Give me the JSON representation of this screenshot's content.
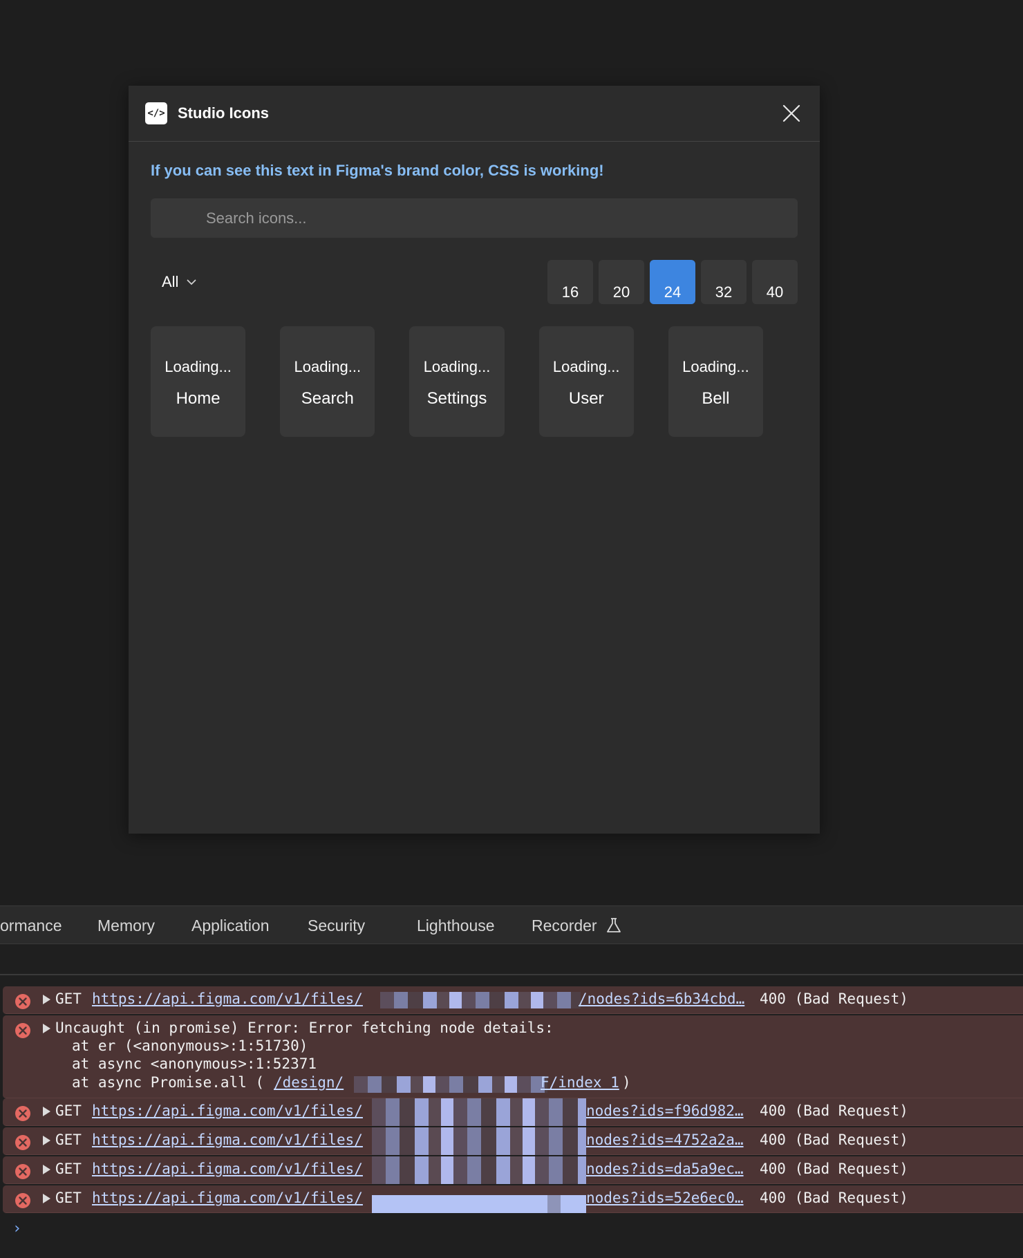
{
  "plugin": {
    "icon_glyph": "</>",
    "title": "Studio Icons",
    "css_message": "If you can see this text in Figma's brand color, CSS is working!",
    "search_placeholder": "Search icons...",
    "filter_value": "All",
    "sizes": [
      "16",
      "20",
      "24",
      "32",
      "40"
    ],
    "selected_size": "24",
    "icons": [
      {
        "status": "Loading...",
        "name": "Home"
      },
      {
        "status": "Loading...",
        "name": "Search"
      },
      {
        "status": "Loading...",
        "name": "Settings"
      },
      {
        "status": "Loading...",
        "name": "User"
      },
      {
        "status": "Loading...",
        "name": "Bell"
      }
    ],
    "colors": {
      "brand": "#87bdf4",
      "selected": "#3d85e0"
    }
  },
  "devtools": {
    "tabs": [
      "ormance",
      "Memory",
      "Application",
      "Security",
      "Lighthouse",
      "Recorder"
    ],
    "logs": [
      {
        "method": "GET",
        "url_start": "https://api.figma.com/v1/files/",
        "url_end": "/nodes?ids=6b34cbd…",
        "status": "400 (Bad Request)"
      },
      {
        "message": "Uncaught (in promise) Error: Error fetching node details:",
        "stack1": "at er (<anonymous>:1:51730)",
        "stack2": "at async <anonymous>:1:52371",
        "stack3_start": "at async Promise.all (",
        "stack3_link_start": "/design/",
        "stack3_link_end": "F/index 1",
        "stack3_end": ")"
      },
      {
        "method": "GET",
        "url_start": "https://api.figma.com/v1/files/",
        "url_end": "nodes?ids=f96d982…",
        "status": "400 (Bad Request)"
      },
      {
        "method": "GET",
        "url_start": "https://api.figma.com/v1/files/",
        "url_end": "nodes?ids=4752a2a…",
        "status": "400 (Bad Request)"
      },
      {
        "method": "GET",
        "url_start": "https://api.figma.com/v1/files/",
        "url_end": "nodes?ids=da5a9ec…",
        "status": "400 (Bad Request)"
      },
      {
        "method": "GET",
        "url_start": "https://api.figma.com/v1/files/",
        "url_end": "nodes?ids=52e6ec0…",
        "status": "400 (Bad Request)"
      }
    ],
    "prompt_glyph": "›"
  }
}
